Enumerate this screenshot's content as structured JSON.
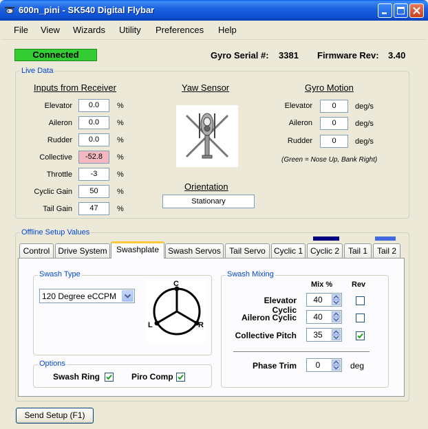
{
  "window": {
    "title": "600n_pini - SK540 Digital Flybar"
  },
  "menu": [
    "File",
    "View",
    "Wizards",
    "Utility",
    "Preferences",
    "Help"
  ],
  "status": {
    "connection": "Connected",
    "gyro_serial_label": "Gyro Serial #:",
    "gyro_serial": "3381",
    "firmware_label": "Firmware Rev:",
    "firmware": "3.40"
  },
  "live_data": {
    "title": "Live Data",
    "inputs": {
      "title": "Inputs from Receiver",
      "rows": [
        {
          "label": "Elevator",
          "value": "0.0",
          "unit": "%"
        },
        {
          "label": "Aileron",
          "value": "0.0",
          "unit": "%"
        },
        {
          "label": "Rudder",
          "value": "0.0",
          "unit": "%"
        },
        {
          "label": "Collective",
          "value": "-52.8",
          "unit": "%"
        },
        {
          "label": "Throttle",
          "value": "-3",
          "unit": "%"
        },
        {
          "label": "Cyclic Gain",
          "value": "50",
          "unit": "%"
        },
        {
          "label": "Tail Gain",
          "value": "47",
          "unit": "%"
        }
      ]
    },
    "yaw_sensor": {
      "title": "Yaw Sensor",
      "icon": "helicopter-icon"
    },
    "orientation": {
      "title": "Orientation",
      "value": "Stationary"
    },
    "gyro_motion": {
      "title": "Gyro Motion",
      "rows": [
        {
          "label": "Elevator",
          "value": "0",
          "unit": "deg/s"
        },
        {
          "label": "Aileron",
          "value": "0",
          "unit": "deg/s"
        },
        {
          "label": "Rudder",
          "value": "0",
          "unit": "deg/s"
        }
      ],
      "note": "(Green = Nose Up, Bank Right)"
    }
  },
  "offline_setup": {
    "title": "Offline Setup Values",
    "tabs": [
      "Control",
      "Drive System",
      "Swashplate",
      "Swash Servos",
      "Tail Servo",
      "Cyclic 1",
      "Cyclic 2",
      "Tail 1",
      "Tail 2"
    ],
    "active_tab": "Swashplate",
    "swash_type": {
      "title": "Swash Type",
      "selected": "120 Degree eCCPM",
      "diagram_labels": {
        "top": "C",
        "left": "L",
        "right": "R"
      }
    },
    "options": {
      "title": "Options",
      "swash_ring_label": "Swash Ring",
      "swash_ring_checked": true,
      "piro_comp_label": "Piro Comp",
      "piro_comp_checked": true
    },
    "swash_mixing": {
      "title": "Swash Mixing",
      "col_mix": "Mix %",
      "col_rev": "Rev",
      "rows": [
        {
          "label": "Elevator Cyclic",
          "value": "40",
          "rev": false
        },
        {
          "label": "Aileron Cyclic",
          "value": "40",
          "rev": false
        },
        {
          "label": "Collective Pitch",
          "value": "35",
          "rev": true
        }
      ],
      "phase_trim_label": "Phase Trim",
      "phase_trim_value": "0",
      "phase_trim_unit": "deg"
    }
  },
  "send_button": "Send Setup (F1)"
}
